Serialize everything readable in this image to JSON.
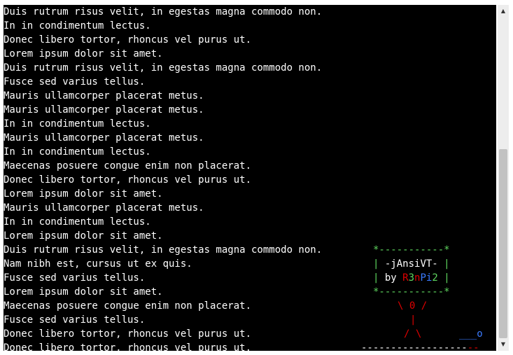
{
  "terminal": {
    "lines": [
      "Duis rutrum risus velit, in egestas magna commodo non.",
      "In in condimentum lectus.",
      "Donec libero tortor, rhoncus vel purus ut.",
      "Lorem ipsum dolor sit amet.",
      "Duis rutrum risus velit, in egestas magna commodo non.",
      "Fusce sed varius tellus.",
      "Mauris ullamcorper placerat metus.",
      "Mauris ullamcorper placerat metus.",
      "In in condimentum lectus.",
      "Mauris ullamcorper placerat metus.",
      "In in condimentum lectus.",
      "Maecenas posuere congue enim non placerat.",
      "Donec libero tortor, rhoncus vel purus ut.",
      "Lorem ipsum dolor sit amet.",
      "Mauris ullamcorper placerat metus.",
      "In in condimentum lectus.",
      "Lorem ipsum dolor sit amet.",
      "Duis rutrum risus velit, in egestas magna commodo non.",
      "Nam nibh est, cursus ut ex quis.",
      "Fusce sed varius tellus.",
      "Lorem ipsum dolor sit amet.",
      "Maecenas posuere congue enim non placerat.",
      "Fusce sed varius tellus.",
      "Donec libero tortor, rhoncus vel purus ut.",
      "Donec libero tortor, rhoncus vel purus ut."
    ]
  },
  "banner": {
    "border_top": "*-----------*",
    "border_bottom": "*-----------*",
    "side": "|",
    "title": " -jAnsiVT- ",
    "by": " by ",
    "author_r": "R",
    "author_3": "3",
    "author_n": "n",
    "author_pi": "Pi",
    "author_2": "2",
    "pad": " "
  },
  "figure": {
    "head": "\\ 0 /",
    "body": "|",
    "legs": "/ \\",
    "ball": "___o",
    "ground_white": "------------------",
    "ground_red": "--"
  },
  "colors": {
    "background": "#000000",
    "text": "#ffffff",
    "green": "#5fd75f",
    "red": "#e00000",
    "blue": "#3a7bff"
  },
  "scrollbar": {
    "up_icon": "▲",
    "down_icon": "▼"
  }
}
